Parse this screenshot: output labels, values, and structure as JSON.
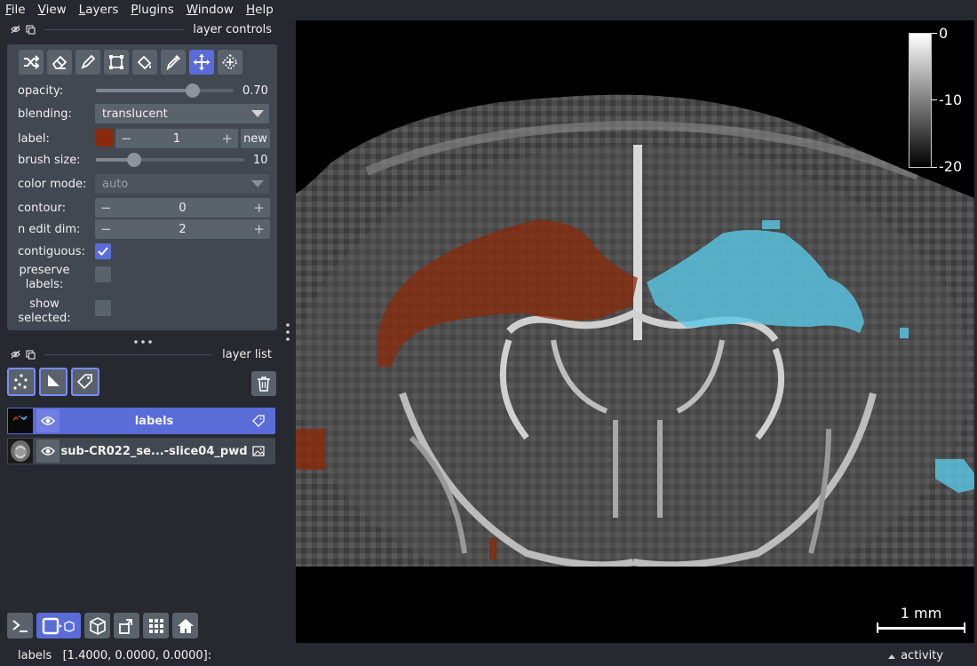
{
  "menubar": {
    "items": [
      {
        "label": "File",
        "mnemonic": "F",
        "rest": "ile"
      },
      {
        "label": "View",
        "mnemonic": "V",
        "rest": "iew"
      },
      {
        "label": "Layers",
        "mnemonic": "L",
        "rest": "ayers"
      },
      {
        "label": "Plugins",
        "mnemonic": "P",
        "rest": "lugins"
      },
      {
        "label": "Window",
        "mnemonic": "W",
        "rest": "indow"
      },
      {
        "label": "Help",
        "mnemonic": "H",
        "rest": "elp"
      }
    ]
  },
  "layer_controls": {
    "title": "layer controls",
    "tools": [
      "shuffle-icon",
      "eraser-icon",
      "paint-brush-icon",
      "polygon-icon",
      "fill-bucket-icon",
      "color-picker-icon",
      "move-icon",
      "transform-icon"
    ],
    "active_tool": "move-icon",
    "opacity": {
      "label": "opacity:",
      "value": "0.70",
      "fraction": 0.7
    },
    "blending": {
      "label": "blending:",
      "value": "translucent"
    },
    "label": {
      "label": "label:",
      "value": "1",
      "new_label": "new",
      "color": "#8a2a0a"
    },
    "brush_size": {
      "label": "brush size:",
      "value": "10",
      "fraction": 0.26
    },
    "color_mode": {
      "label": "color mode:",
      "value": "auto"
    },
    "contour": {
      "label": "contour:",
      "value": "0"
    },
    "n_edit_dim": {
      "label": "n edit dim:",
      "value": "2"
    },
    "contiguous": {
      "label": "contiguous:",
      "checked": true
    },
    "preserve_labels": {
      "label_line1": "preserve",
      "label_line2": "labels:",
      "checked": false
    },
    "show_selected": {
      "label_line1": "show",
      "label_line2": "selected:",
      "checked": false
    }
  },
  "layer_list": {
    "title": "layer list",
    "layers": [
      {
        "name": "labels",
        "type_icon": "label-tag-icon",
        "selected": true
      },
      {
        "name": "sub-CR022_se...-slice04_pwd",
        "type_icon": "image-icon",
        "selected": false
      }
    ]
  },
  "canvas": {
    "colorbar": {
      "labels": [
        "0",
        "-10",
        "-20"
      ]
    },
    "scalebar": {
      "label": "1 mm"
    }
  },
  "statusbar": {
    "text": "labels   [1.4000, 0.0000, 0.0000]:",
    "activity": "activity"
  }
}
